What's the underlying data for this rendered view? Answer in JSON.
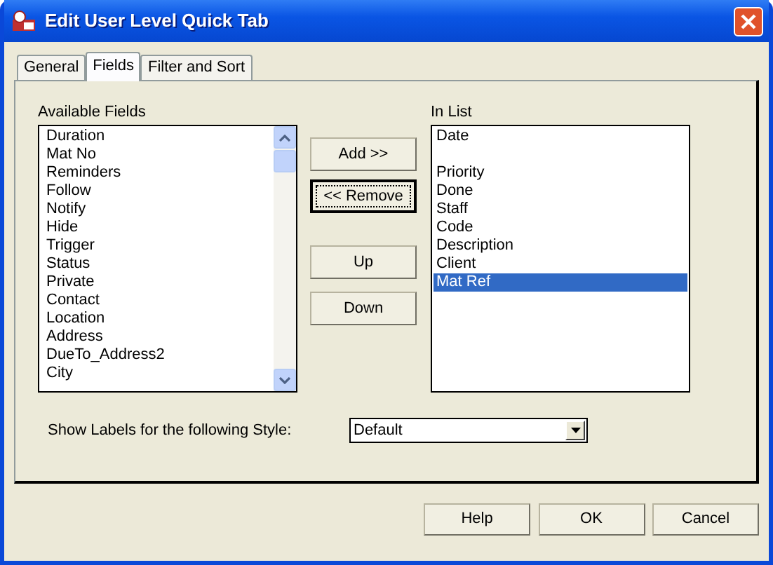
{
  "window": {
    "title": "Edit User Level Quick Tab"
  },
  "tabs": [
    {
      "label": "General",
      "selected": false
    },
    {
      "label": "Fields",
      "selected": true
    },
    {
      "label": "Filter and Sort",
      "selected": false
    }
  ],
  "available_fields": {
    "label": "Available Fields",
    "items": [
      "Duration",
      "Mat No",
      "Reminders",
      "Follow",
      "Notify",
      "Hide",
      "Trigger",
      "Status",
      "Private",
      "Contact",
      "Location",
      "Address",
      "DueTo_Address2",
      "City"
    ]
  },
  "move_buttons": [
    {
      "label": "Add >>",
      "focused": false
    },
    {
      "label": "<< Remove",
      "focused": true
    },
    {
      "label": "Up",
      "focused": false
    },
    {
      "label": "Down",
      "focused": false
    }
  ],
  "in_list": {
    "label": "In List",
    "items": [
      {
        "kind": "field",
        "text": "Date",
        "selected": false
      },
      {
        "kind": "gap"
      },
      {
        "kind": "field",
        "text": "Priority",
        "selected": false
      },
      {
        "kind": "field",
        "text": "Done",
        "selected": false
      },
      {
        "kind": "field",
        "text": "Staff",
        "selected": false
      },
      {
        "kind": "field",
        "text": "Code",
        "selected": false
      },
      {
        "kind": "field",
        "text": "Description",
        "selected": false
      },
      {
        "kind": "field",
        "text": "Client",
        "selected": false
      },
      {
        "kind": "field",
        "text": "Mat Ref",
        "selected": true
      }
    ]
  },
  "style_select": {
    "label": "Show Labels for the following Style:",
    "value": "Default"
  },
  "buttons": [
    "Help",
    "OK",
    "Cancel"
  ]
}
